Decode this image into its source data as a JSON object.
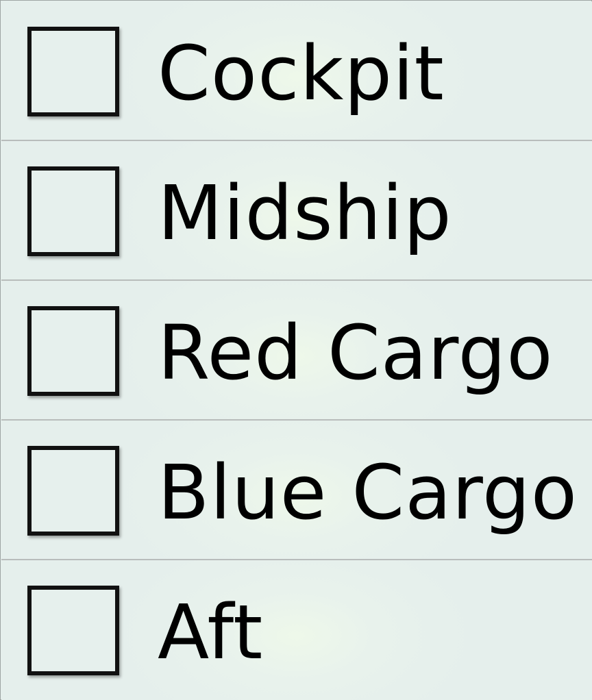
{
  "locations": [
    {
      "label": "Cockpit",
      "checked": false
    },
    {
      "label": "Midship",
      "checked": false
    },
    {
      "label": "Red Cargo",
      "checked": false
    },
    {
      "label": "Blue Cargo",
      "checked": false
    },
    {
      "label": "Aft",
      "checked": false
    }
  ]
}
